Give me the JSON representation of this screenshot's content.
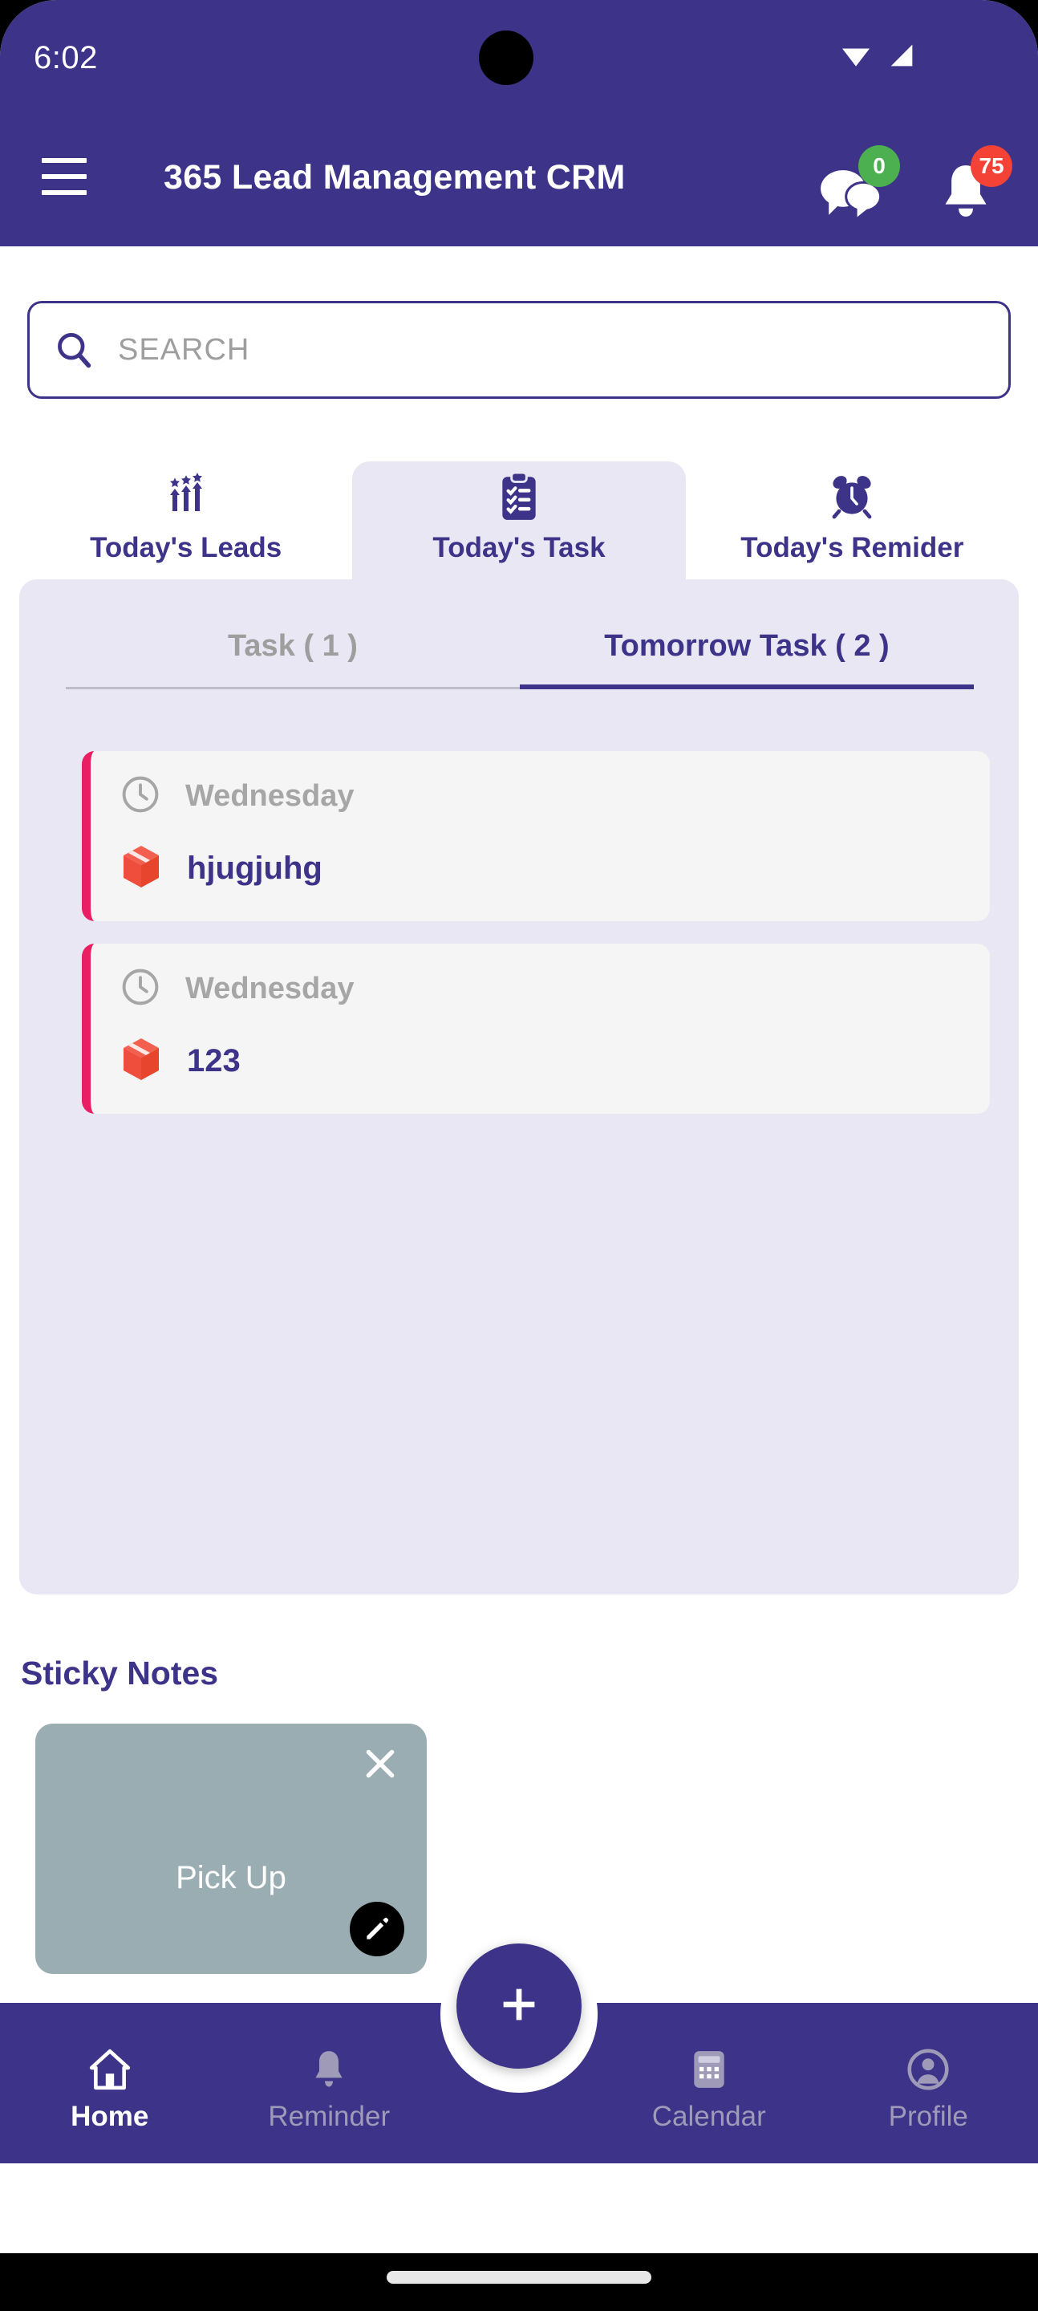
{
  "status_bar": {
    "time": "6:02",
    "wifi_icon": "wifi-icon",
    "signal_icon": "cellular-signal-icon"
  },
  "app_bar": {
    "menu_icon": "hamburger-menu-icon",
    "title": "365 Lead Management CRM",
    "chat": {
      "icon": "chat-bubbles-icon",
      "badge": "0",
      "badge_color": "#4caf50"
    },
    "notifications": {
      "icon": "bell-icon",
      "badge": "75",
      "badge_color": "#f44336"
    }
  },
  "search": {
    "icon": "search-icon",
    "placeholder": "SEARCH",
    "value": ""
  },
  "top_tabs": [
    {
      "label": "Today's Leads",
      "icon": "growth-arrows-stars-icon",
      "active": false
    },
    {
      "label": "Today's Task",
      "icon": "clipboard-checklist-icon",
      "active": true
    },
    {
      "label": "Today's Remider",
      "icon": "alarm-clock-icon",
      "active": false
    }
  ],
  "sub_tabs": [
    {
      "label": "Task ( 1 )",
      "active": false
    },
    {
      "label": "Tomorrow Task ( 2 )",
      "active": true
    }
  ],
  "tasks": [
    {
      "day": "Wednesday",
      "title": "hjugjuhg",
      "clock_icon": "clock-icon",
      "box_icon": "package-box-icon"
    },
    {
      "day": "Wednesday",
      "title": "123",
      "clock_icon": "clock-icon",
      "box_icon": "package-box-icon"
    }
  ],
  "sticky_notes": {
    "heading": "Sticky Notes",
    "items": [
      {
        "text": "Pick Up",
        "close_icon": "close-icon",
        "edit_icon": "pencil-edit-icon",
        "color": "#9aadb3"
      }
    ]
  },
  "fab": {
    "label": "+",
    "icon": "plus-icon"
  },
  "bottom_nav": [
    {
      "label": "Home",
      "icon": "home-icon",
      "active": true
    },
    {
      "label": "Reminder",
      "icon": "bell-icon",
      "active": false
    },
    {
      "label": "Calendar",
      "icon": "calendar-icon",
      "active": false
    },
    {
      "label": "Profile",
      "icon": "person-circle-icon",
      "active": false
    }
  ],
  "colors": {
    "primary": "#3d3389",
    "panel": "#e9e7f3",
    "accent_pink": "#e91e63",
    "badge_green": "#4caf50",
    "badge_red": "#f44336",
    "sticky": "#9aadb3"
  }
}
